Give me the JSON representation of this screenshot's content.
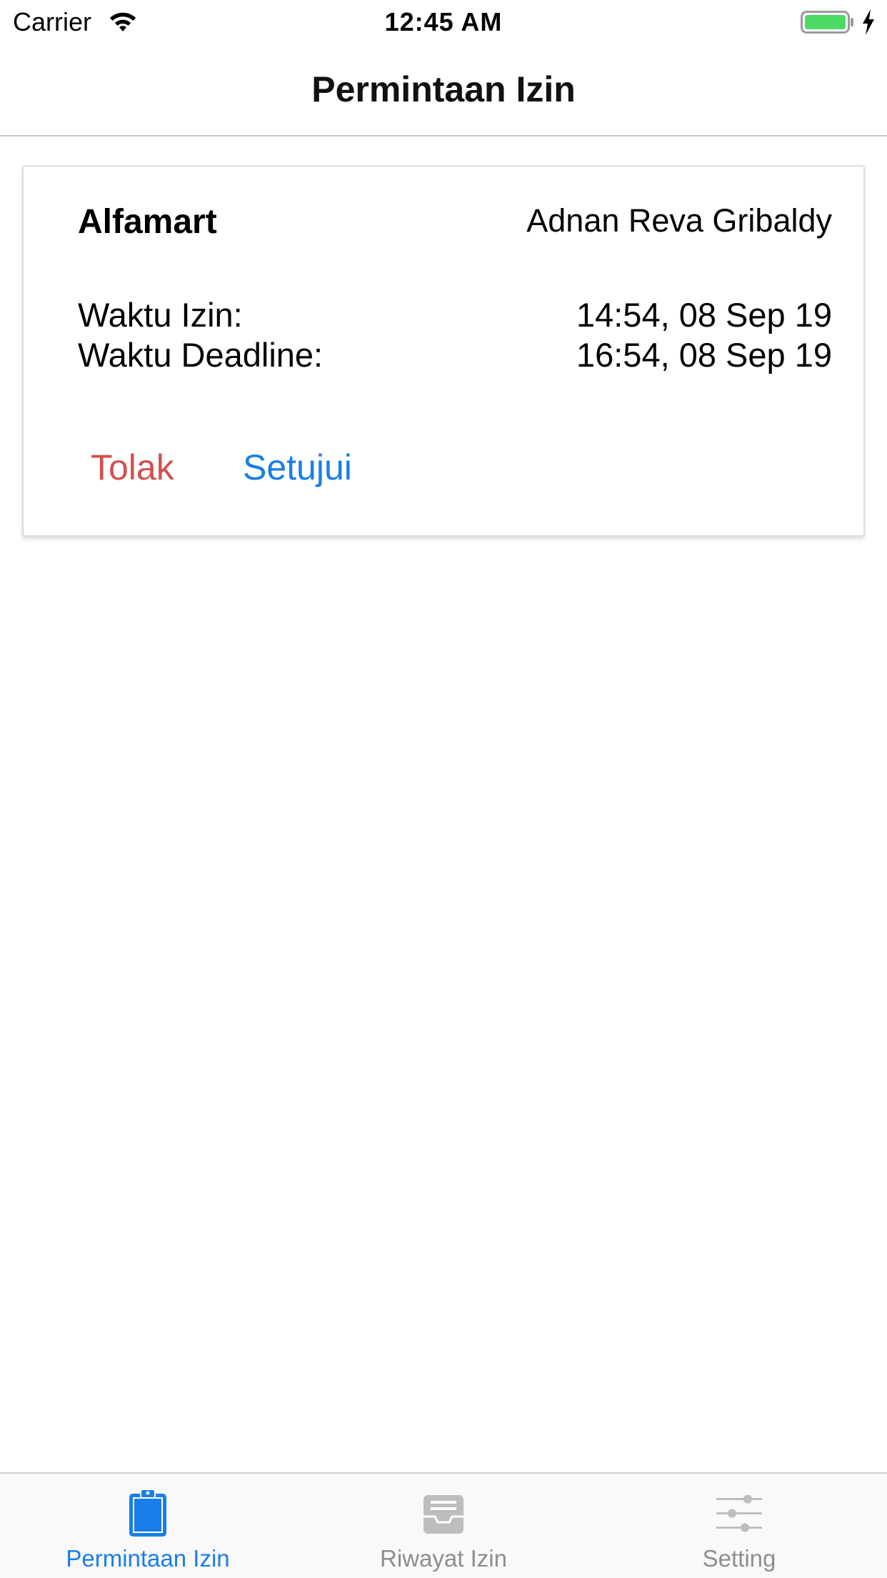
{
  "status_bar": {
    "carrier": "Carrier",
    "time": "12:45 AM",
    "icons": [
      "wifi-icon",
      "battery-icon",
      "charging-bolt-icon"
    ],
    "battery_color": "#4cd964"
  },
  "nav": {
    "title": "Permintaan Izin"
  },
  "request_card": {
    "company": "Alfamart",
    "requester": "Adnan Reva Gribaldy",
    "permit_time_label": "Waktu Izin:",
    "permit_time_value": "14:54, 08 Sep 19",
    "deadline_label": "Waktu Deadline:",
    "deadline_value": "16:54, 08 Sep 19",
    "reject_label": "Tolak",
    "approve_label": "Setujui",
    "reject_color": "#d0514e",
    "approve_color": "#1a7ee8"
  },
  "tab_bar": {
    "tabs": [
      {
        "label": "Permintaan Izin",
        "icon": "clipboard-icon",
        "active": true
      },
      {
        "label": "Riwayat Izin",
        "icon": "inbox-tray-icon",
        "active": false
      },
      {
        "label": "Setting",
        "icon": "sliders-icon",
        "active": false
      }
    ],
    "active_color": "#1a7ee8",
    "inactive_color": "#8e8e8e"
  }
}
